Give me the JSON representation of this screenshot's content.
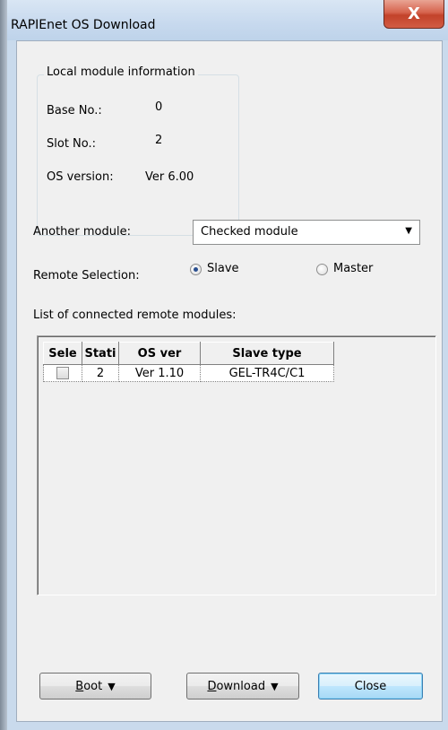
{
  "window": {
    "title": "RAPIEnet OS Download",
    "close_glyph": "X"
  },
  "local_module": {
    "legend": "Local module information",
    "base_label": "Base No.:",
    "base_value": "0",
    "slot_label": "Slot No.:",
    "slot_value": "2",
    "os_label": "OS version:",
    "os_value": "Ver 6.00"
  },
  "another_module": {
    "label": "Another module:",
    "selected": "Checked module",
    "arrow_icon": "chevron-down-icon"
  },
  "remote_selection": {
    "label": "Remote Selection:",
    "options": [
      {
        "label": "Slave",
        "checked": true
      },
      {
        "label": "Master",
        "checked": false
      }
    ]
  },
  "connected_list": {
    "label": "List of connected remote modules:",
    "columns": [
      "Sele",
      "Stati",
      "OS ver",
      "Slave type"
    ],
    "rows": [
      {
        "selected": false,
        "station": "2",
        "os_ver": "Ver 1.10",
        "slave_type": "GEL-TR4C/C1"
      }
    ]
  },
  "buttons": {
    "boot_prefix": "B",
    "boot_rest": "oot",
    "download_prefix": "D",
    "download_rest": "ownload",
    "dropdown_glyph": "▼",
    "close": "Close"
  },
  "colors": {
    "close_button": "#c2422a",
    "titlebar": "#c7d9ee",
    "primary_button_border": "#3c7fb1"
  }
}
